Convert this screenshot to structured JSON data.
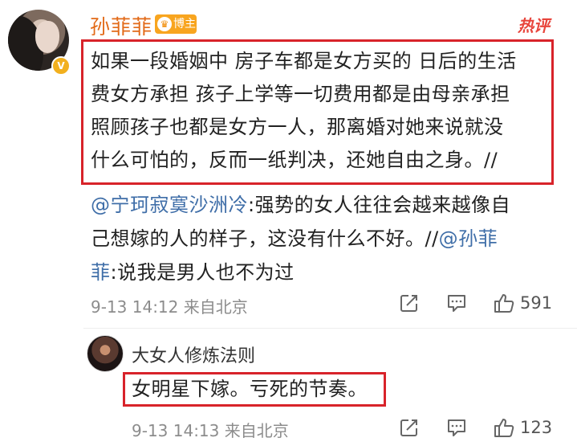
{
  "main_comment": {
    "username": "孙菲菲",
    "badge_label": "博主",
    "hot_tag": "热评",
    "text_lines": [
      "如果一段婚姻中 房子车都是女方买的 日后的生活",
      "费女方承担  孩子上学等一切费用都是由母亲承担",
      "照顾孩子也都是女方一人，那离婚对她来说就没",
      "什么可怕的，反而一纸判决，还她自由之身。//"
    ],
    "repost": {
      "mention1": "@宁珂寂寞沙洲冷",
      "text1": ":强势的女人往往会越来越像自",
      "line2": "己想嫁的人的样子，这没有什么不好。//",
      "mention2_part1": "@孙菲",
      "mention2_part2": "菲",
      "text2": ":说我是男人也不为过"
    },
    "meta": "9-13 14:12  来自北京",
    "like_count": "591"
  },
  "reply": {
    "username": "大女人修炼法则",
    "text": "女明星下嫁。亏死的节奏。",
    "meta": "9-13 14:13  来自北京",
    "like_count": "123"
  },
  "icons": [
    "share-icon",
    "comment-icon",
    "like-icon",
    "verified-icon",
    "crown-icon"
  ],
  "colors": {
    "username": "#e26a18",
    "mention": "#3f6ea8",
    "highlight": "#d8232a",
    "hot": "#e8453c",
    "badge": "#f8a51f"
  }
}
